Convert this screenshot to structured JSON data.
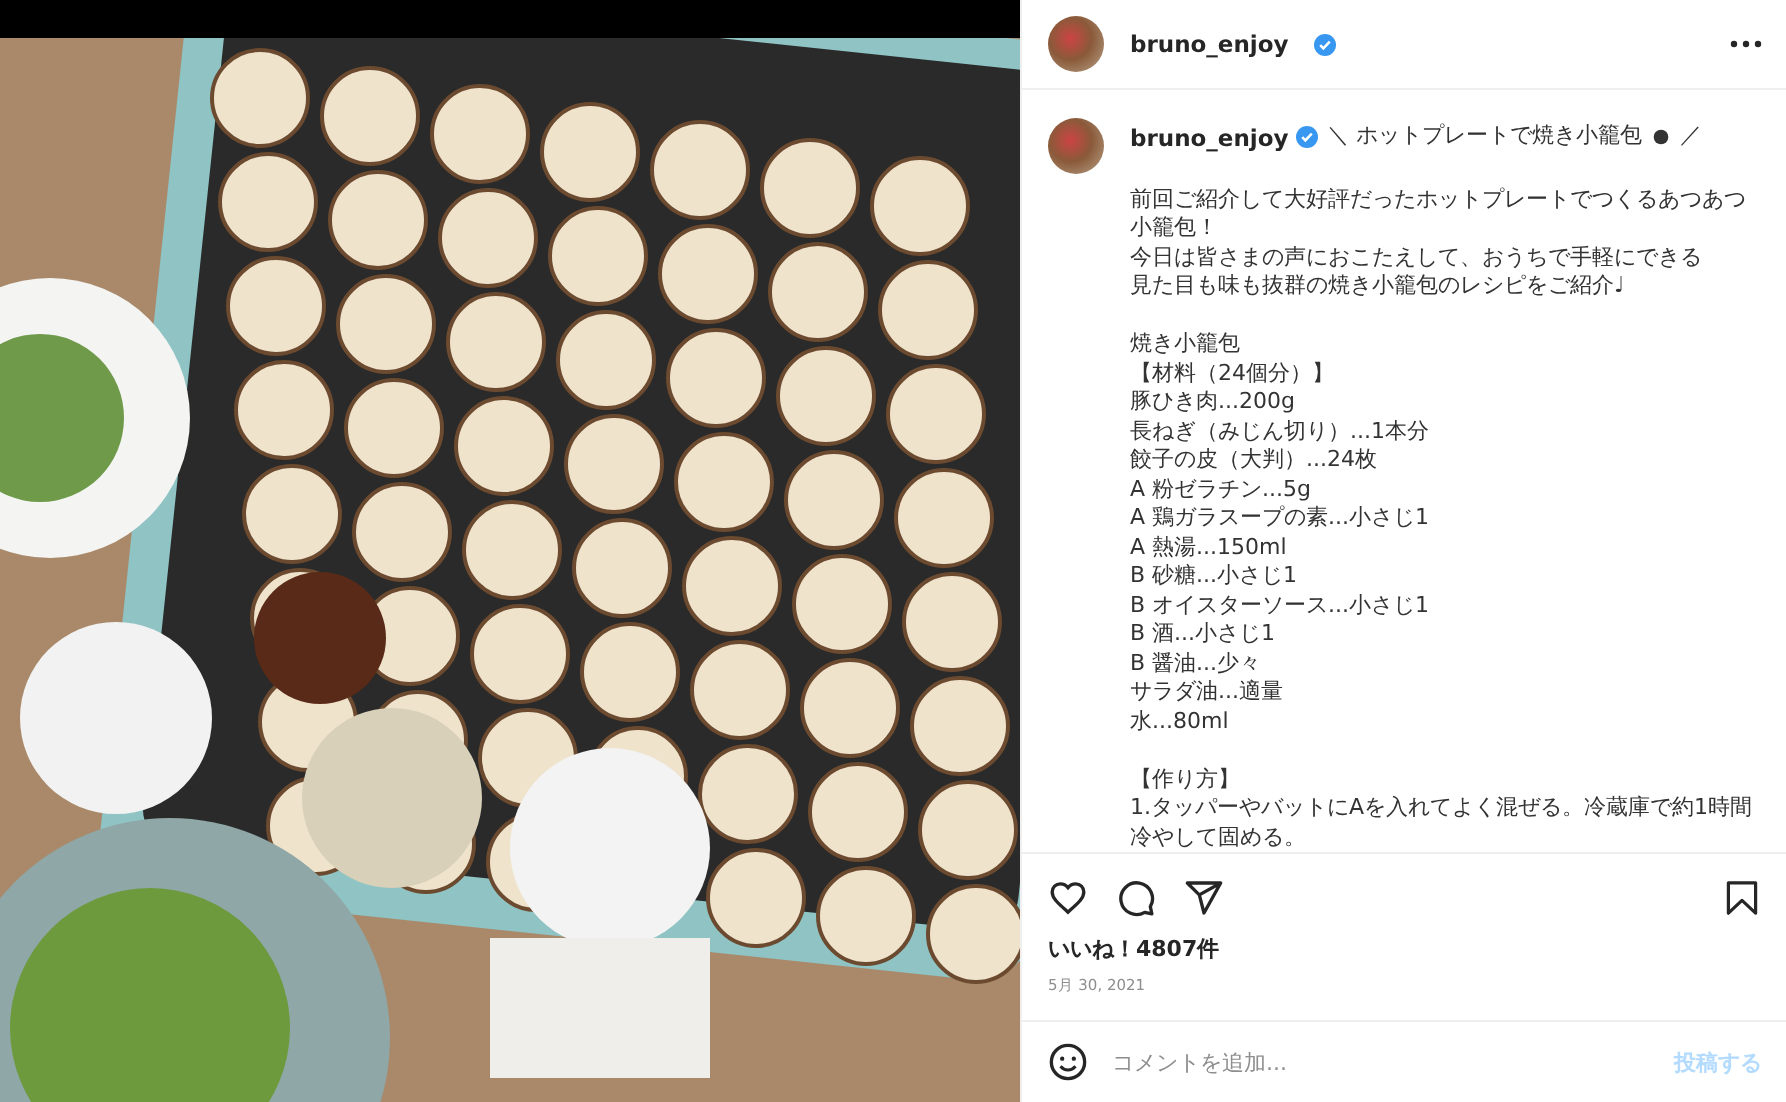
{
  "post": {
    "author": "bruno_enjoy",
    "verified": true
  },
  "caption": {
    "author": "bruno_enjoy",
    "verified": true,
    "title_start": "＼ ホットプレートで焼き小籠包",
    "title_end": "／",
    "paragraphs": [
      [
        "前回ご紹介して大好評だったホットプレートでつくるあつあつ小籠包！",
        "今日は皆さまの声におこたえして、おうちで手軽にできる",
        "見た目も味も抜群の焼き小籠包のレシピをご紹介♩"
      ],
      [
        "焼き小籠包",
        "【材料（24個分）】",
        "豚ひき肉...200g",
        "長ねぎ（みじん切り）...1本分",
        "餃子の皮（大判）...24枚",
        "A 粉ゼラチン...5g",
        "A 鶏ガラスープの素...小さじ1",
        "A 熱湯...150ml",
        "B 砂糖...小さじ1",
        "B オイスターソース...小さじ1",
        "B 酒...小さじ1",
        "B 醤油...少々",
        "サラダ油...適量",
        "水...80ml"
      ],
      [
        "【作り方】",
        "1.タッパーやバットにAを入れてよく混ぜる。冷蔵庫で約1時間冷やして固める。"
      ]
    ]
  },
  "likes": "いいね！4807件",
  "date": "5月 30, 2021",
  "comment": {
    "placeholder": "コメントを追加...",
    "post_button": "投稿する",
    "disabled": true
  }
}
